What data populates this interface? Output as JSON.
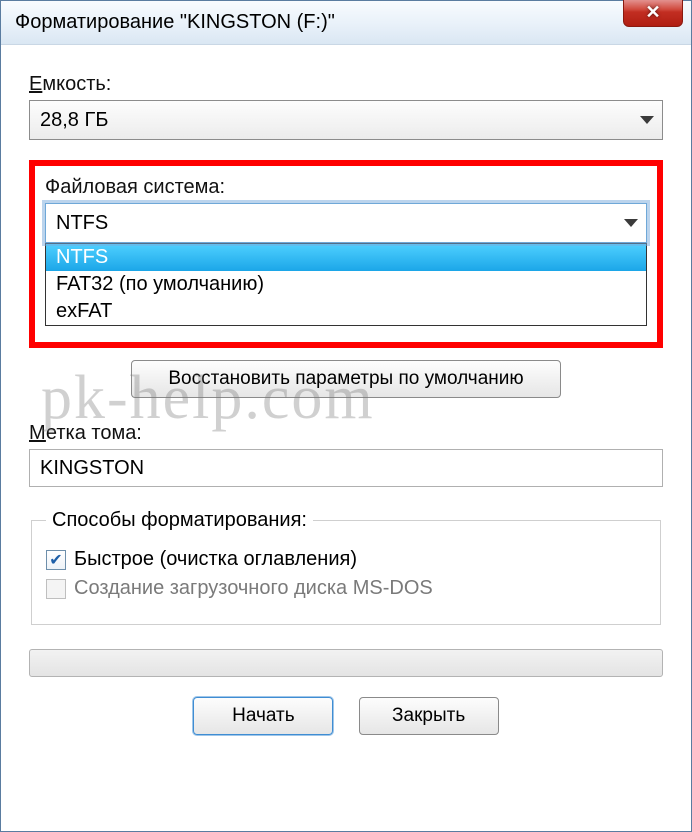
{
  "window": {
    "title": "Форматирование \"KINGSTON (F:)\"",
    "close_glyph": "✕"
  },
  "capacity": {
    "label_pre": "Е",
    "label_post": "мкость:",
    "value": "28,8 ГБ"
  },
  "filesystem": {
    "label": "Файловая система:",
    "value": "NTFS",
    "options": [
      "NTFS",
      "FAT32 (по умолчанию)",
      "exFAT"
    ]
  },
  "restore_button": "Восстановить параметры по умолчанию",
  "volume_label": {
    "label_pre": "М",
    "label_post": "етка тома:",
    "value": "KINGSTON"
  },
  "format_ways": {
    "legend": "Способы форматирования:",
    "quick": "Быстрое (очистка оглавления)",
    "msdos": "Создание загрузочного диска MS-DOS"
  },
  "buttons": {
    "start": "Начать",
    "close": "Закрыть"
  },
  "watermark": "pk-help.com"
}
